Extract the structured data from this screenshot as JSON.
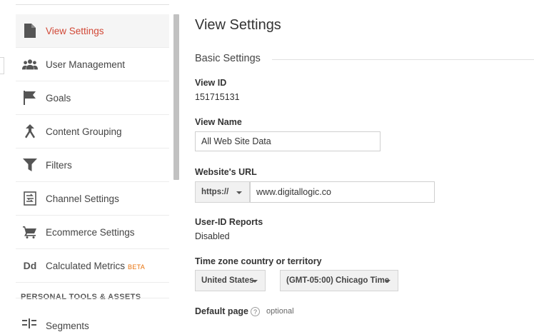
{
  "sidebar": {
    "items": [
      {
        "label": "View Settings",
        "icon": "document-icon",
        "active": true
      },
      {
        "label": "User Management",
        "icon": "people-icon"
      },
      {
        "label": "Goals",
        "icon": "flag-icon"
      },
      {
        "label": "Content Grouping",
        "icon": "grouping-icon"
      },
      {
        "label": "Filters",
        "icon": "filter-icon"
      },
      {
        "label": "Channel Settings",
        "icon": "channel-icon"
      },
      {
        "label": "Ecommerce Settings",
        "icon": "cart-icon"
      },
      {
        "label": "Calculated Metrics",
        "badge": "BETA",
        "icon": "dd-icon"
      }
    ],
    "icon_text_dd": "Dd",
    "section_title": "PERSONAL TOOLS & ASSETS",
    "partial_item": {
      "label": "Segments",
      "icon": "segments-icon"
    }
  },
  "main": {
    "title": "View Settings",
    "section": "Basic Settings",
    "view_id": {
      "label": "View ID",
      "value": "151715131"
    },
    "view_name": {
      "label": "View Name",
      "value": "All Web Site Data"
    },
    "website_url": {
      "label": "Website's URL",
      "protocol": "https://",
      "value": "www.digitallogic.co"
    },
    "user_id_reports": {
      "label": "User-ID Reports",
      "value": "Disabled"
    },
    "timezone": {
      "label": "Time zone country or territory",
      "country": "United States",
      "zone": "(GMT-05:00) Chicago Time"
    },
    "default_page": {
      "label": "Default page",
      "help": "?",
      "hint": "optional"
    }
  },
  "colors": {
    "active": "#d14836",
    "beta": "#e8710a",
    "icon": "#555555"
  }
}
